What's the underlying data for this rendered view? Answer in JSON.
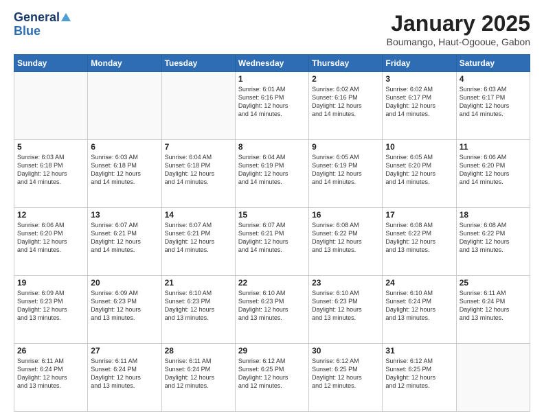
{
  "logo": {
    "general": "General",
    "blue": "Blue"
  },
  "header": {
    "month": "January 2025",
    "location": "Boumango, Haut-Ogooue, Gabon"
  },
  "weekdays": [
    "Sunday",
    "Monday",
    "Tuesday",
    "Wednesday",
    "Thursday",
    "Friday",
    "Saturday"
  ],
  "weeks": [
    [
      {
        "day": "",
        "info": ""
      },
      {
        "day": "",
        "info": ""
      },
      {
        "day": "",
        "info": ""
      },
      {
        "day": "1",
        "info": "Sunrise: 6:01 AM\nSunset: 6:16 PM\nDaylight: 12 hours\nand 14 minutes."
      },
      {
        "day": "2",
        "info": "Sunrise: 6:02 AM\nSunset: 6:16 PM\nDaylight: 12 hours\nand 14 minutes."
      },
      {
        "day": "3",
        "info": "Sunrise: 6:02 AM\nSunset: 6:17 PM\nDaylight: 12 hours\nand 14 minutes."
      },
      {
        "day": "4",
        "info": "Sunrise: 6:03 AM\nSunset: 6:17 PM\nDaylight: 12 hours\nand 14 minutes."
      }
    ],
    [
      {
        "day": "5",
        "info": "Sunrise: 6:03 AM\nSunset: 6:18 PM\nDaylight: 12 hours\nand 14 minutes."
      },
      {
        "day": "6",
        "info": "Sunrise: 6:03 AM\nSunset: 6:18 PM\nDaylight: 12 hours\nand 14 minutes."
      },
      {
        "day": "7",
        "info": "Sunrise: 6:04 AM\nSunset: 6:18 PM\nDaylight: 12 hours\nand 14 minutes."
      },
      {
        "day": "8",
        "info": "Sunrise: 6:04 AM\nSunset: 6:19 PM\nDaylight: 12 hours\nand 14 minutes."
      },
      {
        "day": "9",
        "info": "Sunrise: 6:05 AM\nSunset: 6:19 PM\nDaylight: 12 hours\nand 14 minutes."
      },
      {
        "day": "10",
        "info": "Sunrise: 6:05 AM\nSunset: 6:20 PM\nDaylight: 12 hours\nand 14 minutes."
      },
      {
        "day": "11",
        "info": "Sunrise: 6:06 AM\nSunset: 6:20 PM\nDaylight: 12 hours\nand 14 minutes."
      }
    ],
    [
      {
        "day": "12",
        "info": "Sunrise: 6:06 AM\nSunset: 6:20 PM\nDaylight: 12 hours\nand 14 minutes."
      },
      {
        "day": "13",
        "info": "Sunrise: 6:07 AM\nSunset: 6:21 PM\nDaylight: 12 hours\nand 14 minutes."
      },
      {
        "day": "14",
        "info": "Sunrise: 6:07 AM\nSunset: 6:21 PM\nDaylight: 12 hours\nand 14 minutes."
      },
      {
        "day": "15",
        "info": "Sunrise: 6:07 AM\nSunset: 6:21 PM\nDaylight: 12 hours\nand 14 minutes."
      },
      {
        "day": "16",
        "info": "Sunrise: 6:08 AM\nSunset: 6:22 PM\nDaylight: 12 hours\nand 13 minutes."
      },
      {
        "day": "17",
        "info": "Sunrise: 6:08 AM\nSunset: 6:22 PM\nDaylight: 12 hours\nand 13 minutes."
      },
      {
        "day": "18",
        "info": "Sunrise: 6:08 AM\nSunset: 6:22 PM\nDaylight: 12 hours\nand 13 minutes."
      }
    ],
    [
      {
        "day": "19",
        "info": "Sunrise: 6:09 AM\nSunset: 6:23 PM\nDaylight: 12 hours\nand 13 minutes."
      },
      {
        "day": "20",
        "info": "Sunrise: 6:09 AM\nSunset: 6:23 PM\nDaylight: 12 hours\nand 13 minutes."
      },
      {
        "day": "21",
        "info": "Sunrise: 6:10 AM\nSunset: 6:23 PM\nDaylight: 12 hours\nand 13 minutes."
      },
      {
        "day": "22",
        "info": "Sunrise: 6:10 AM\nSunset: 6:23 PM\nDaylight: 12 hours\nand 13 minutes."
      },
      {
        "day": "23",
        "info": "Sunrise: 6:10 AM\nSunset: 6:23 PM\nDaylight: 12 hours\nand 13 minutes."
      },
      {
        "day": "24",
        "info": "Sunrise: 6:10 AM\nSunset: 6:24 PM\nDaylight: 12 hours\nand 13 minutes."
      },
      {
        "day": "25",
        "info": "Sunrise: 6:11 AM\nSunset: 6:24 PM\nDaylight: 12 hours\nand 13 minutes."
      }
    ],
    [
      {
        "day": "26",
        "info": "Sunrise: 6:11 AM\nSunset: 6:24 PM\nDaylight: 12 hours\nand 13 minutes."
      },
      {
        "day": "27",
        "info": "Sunrise: 6:11 AM\nSunset: 6:24 PM\nDaylight: 12 hours\nand 13 minutes."
      },
      {
        "day": "28",
        "info": "Sunrise: 6:11 AM\nSunset: 6:24 PM\nDaylight: 12 hours\nand 12 minutes."
      },
      {
        "day": "29",
        "info": "Sunrise: 6:12 AM\nSunset: 6:25 PM\nDaylight: 12 hours\nand 12 minutes."
      },
      {
        "day": "30",
        "info": "Sunrise: 6:12 AM\nSunset: 6:25 PM\nDaylight: 12 hours\nand 12 minutes."
      },
      {
        "day": "31",
        "info": "Sunrise: 6:12 AM\nSunset: 6:25 PM\nDaylight: 12 hours\nand 12 minutes."
      },
      {
        "day": "",
        "info": ""
      }
    ]
  ]
}
